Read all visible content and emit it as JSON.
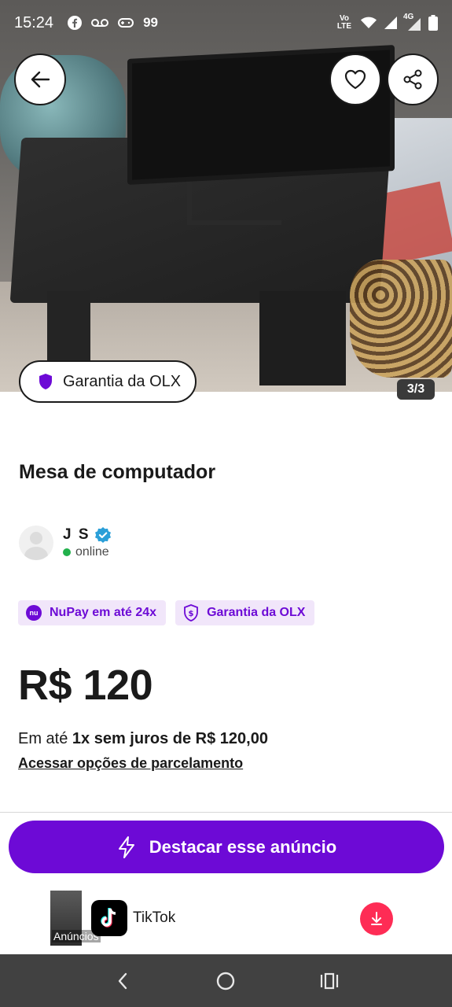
{
  "status_bar": {
    "time": "15:24",
    "left_icons": [
      "facebook-icon",
      "voicemail-icon",
      "gamepad-icon",
      "99-icon"
    ],
    "badge_99": "99",
    "network_label": "Vo LTE",
    "network_type": "4G",
    "right_icons": [
      "volte-icon",
      "wifi-icon",
      "signal-icon",
      "signal-4g-icon",
      "battery-icon"
    ]
  },
  "photo": {
    "counter": "3/3",
    "garantia_label": "Garantia da OLX"
  },
  "listing": {
    "title": "Mesa de computador",
    "seller": {
      "name": "J S",
      "verified": true,
      "status": "online"
    },
    "badges": [
      {
        "label": "NuPay em até 24x",
        "logo_text": "nu"
      },
      {
        "label": "Garantia da OLX"
      }
    ],
    "price": "R$ 120",
    "installments_prefix": "Em até",
    "installments_bold": "1x sem juros de R$ 120,00",
    "installments_link": "Acessar opções de parcelamento"
  },
  "cta": {
    "label": "Destacar esse anúncio"
  },
  "ad": {
    "thumb_label": "Anúncios",
    "app_name": "TikTok"
  },
  "colors": {
    "accent": "#6d0ad6",
    "accent_light": "#f1e6fa",
    "online": "#22b14c",
    "tiktok_red": "#fe2c55",
    "nav_bar": "#414141"
  }
}
